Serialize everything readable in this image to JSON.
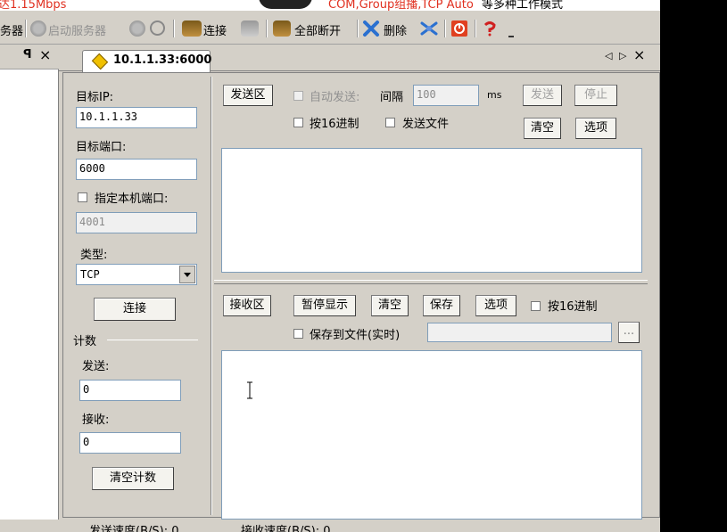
{
  "banner": {
    "left_text": "达1.15Mbps",
    "right_highlight": "COM,Group组播,TCP Auto",
    "right_text": "等多种工作模式"
  },
  "toolbar": {
    "items": [
      {
        "label": "务器",
        "icon": "server-icon",
        "enabled": true
      },
      {
        "label": "启动服务器",
        "icon": "start-server-icon",
        "enabled": false
      },
      {
        "label": "",
        "icon": "stop-server-icon",
        "enabled": false
      },
      {
        "label": "",
        "icon": "stop-circle-icon",
        "enabled": false
      },
      {
        "label": "连接",
        "icon": "connect-icon",
        "enabled": true
      },
      {
        "label": "",
        "icon": "disconnect-icon",
        "enabled": false
      },
      {
        "label": "全部断开",
        "icon": "disconnect-all-icon",
        "enabled": true
      },
      {
        "label": "删除",
        "icon": "delete-icon",
        "enabled": true
      },
      {
        "label": "",
        "icon": "delete-all-icon",
        "enabled": true
      },
      {
        "label": "",
        "icon": "exit-icon",
        "enabled": true
      },
      {
        "label": "",
        "icon": "help-icon",
        "enabled": true
      }
    ]
  },
  "left_panel": {
    "pin": "ᵖ",
    "close": "×"
  },
  "tab": {
    "title": "10.1.1.33:6000",
    "nav_left": "◁",
    "nav_right": "▷",
    "close": "×"
  },
  "connection": {
    "target_ip_label": "目标IP:",
    "target_ip_value": "10.1.1.33",
    "target_port_label": "目标端口:",
    "target_port_value": "6000",
    "local_port_checkbox_label": "指定本机端口:",
    "local_port_value": "4001",
    "type_label": "类型:",
    "type_value": "TCP",
    "connect_button": "连接"
  },
  "counter": {
    "group_label": "计数",
    "send_label": "发送:",
    "send_value": "0",
    "receive_label": "接收:",
    "receive_value": "0",
    "clear_button": "清空计数"
  },
  "send_area": {
    "title_button": "发送区",
    "auto_send_label": "自动发送:",
    "interval_label": "间隔",
    "interval_value": "100",
    "interval_unit": "ms",
    "send_button": "发送",
    "stop_button": "停止",
    "hex_label": "按16进制",
    "send_file_label": "发送文件",
    "clear_button": "清空",
    "options_button": "选项"
  },
  "receive_area": {
    "title_button": "接收区",
    "pause_button": "暂停显示",
    "clear_button": "清空",
    "save_button": "保存",
    "options_button": "选项",
    "hex_label": "按16进制",
    "save_to_file_label": "保存到文件(实时)",
    "browse_button": "...",
    "file_path_value": ""
  },
  "status_bar": {
    "send_speed": "发送速度(B/S): 0",
    "receive_speed": "接收速度(B/S): 0"
  }
}
